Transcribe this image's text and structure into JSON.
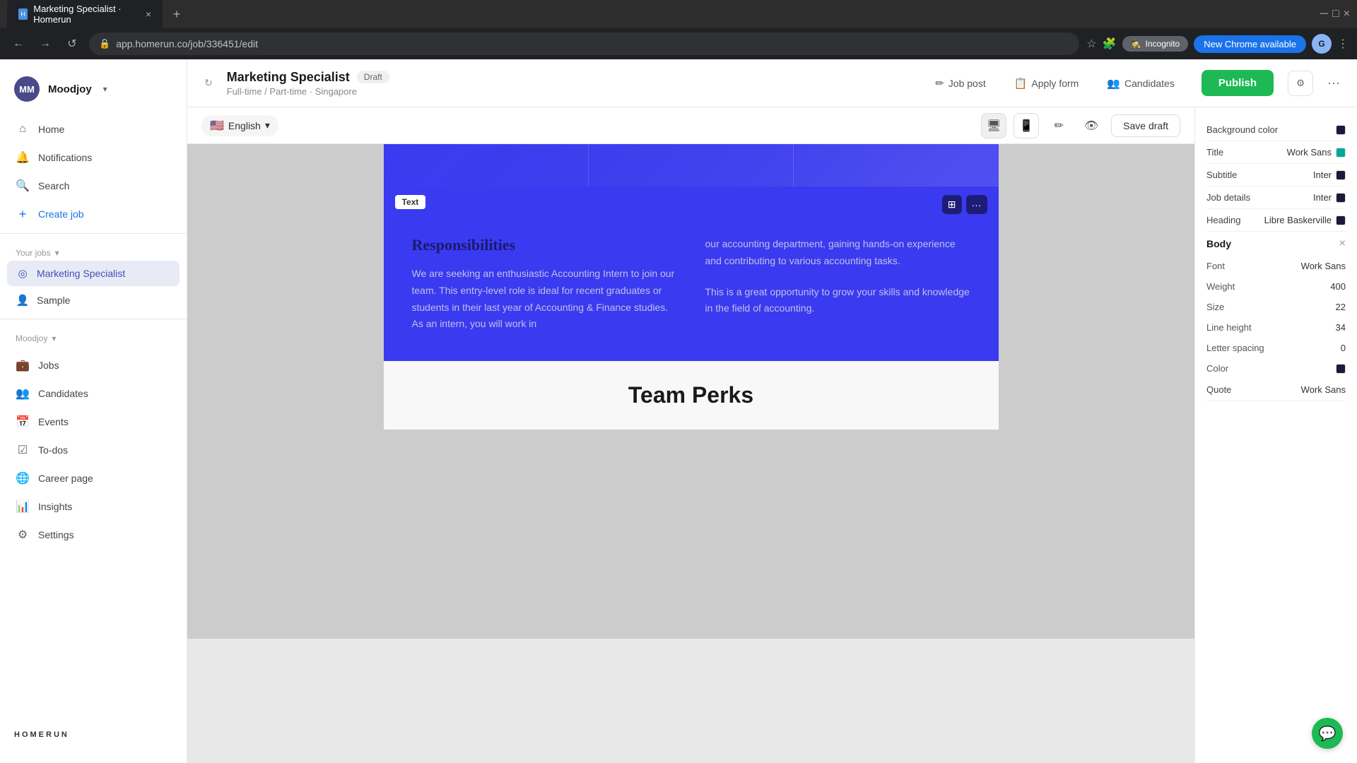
{
  "browser": {
    "tab_title": "Marketing Specialist · Homerun",
    "url": "app.homerun.co/job/336451/edit",
    "new_chrome_label": "New Chrome available",
    "incognito_label": "Incognito"
  },
  "sidebar": {
    "company": "Moodjoy",
    "avatar": "MM",
    "nav_items": [
      {
        "label": "Home",
        "icon": "⌂"
      },
      {
        "label": "Notifications",
        "icon": "🔔"
      },
      {
        "label": "Search",
        "icon": "🔍"
      },
      {
        "label": "Create job",
        "icon": "+"
      }
    ],
    "your_jobs_label": "Your jobs",
    "job_items": [
      {
        "label": "Marketing Specialist",
        "active": true
      },
      {
        "label": "Sample",
        "active": false
      }
    ],
    "moodjoy_label": "Moodjoy",
    "moodjoy_items": [
      {
        "label": "Jobs",
        "icon": "💼"
      },
      {
        "label": "Candidates",
        "icon": "👤"
      },
      {
        "label": "Events",
        "icon": "📅"
      },
      {
        "label": "To-dos",
        "icon": "☑"
      },
      {
        "label": "Career page",
        "icon": "🌐"
      },
      {
        "label": "Insights",
        "icon": "📊"
      },
      {
        "label": "Settings",
        "icon": "⚙"
      }
    ],
    "footer_logo": "HOMERUN"
  },
  "topbar": {
    "job_title": "Marketing Specialist",
    "badge": "Draft",
    "job_meta": "Full-time / Part-time · Singapore",
    "tabs": [
      {
        "label": "Job post",
        "icon": "✏",
        "active": false
      },
      {
        "label": "Apply form",
        "icon": "📋",
        "active": false
      },
      {
        "label": "Candidates",
        "icon": "👥",
        "active": false
      }
    ],
    "publish_label": "Publish",
    "settings_icon": "⚙",
    "more_icon": "···"
  },
  "editor_toolbar": {
    "language": "English",
    "flag": "🇺🇸",
    "device_desktop": "🖥",
    "device_mobile": "📱",
    "edit_icon": "✏",
    "preview_icon": "👁",
    "save_draft": "Save draft"
  },
  "canvas": {
    "text_block_label": "Text",
    "section_title": "Responsibilities",
    "col1_text": "We are seeking an enthusiastic Accounting Intern to join our team. This entry-level role is ideal for recent graduates or students in their last year of Accounting & Finance studies. As an intern, you will work in",
    "col2_text1": "our accounting department, gaining hands-on experience and contributing to various accounting tasks.",
    "col2_text2": "This is a great opportunity to grow your skills and knowledge in the field of accounting.",
    "team_perks": "Team Perks"
  },
  "right_panel": {
    "background_color_label": "Background color",
    "typography_items": [
      {
        "label": "Title",
        "font": "Work Sans",
        "has_color": true,
        "color_class": "color-teal"
      },
      {
        "label": "Subtitle",
        "font": "Inter",
        "has_color": true,
        "color_class": "color-dark"
      },
      {
        "label": "Job details",
        "font": "Inter",
        "has_color": true,
        "color_class": "color-dark"
      },
      {
        "label": "Heading",
        "font": "Libre Baskerville",
        "has_color": true,
        "color_class": "color-dark"
      }
    ],
    "body_section": {
      "title": "Body",
      "font_label": "Font",
      "font_value": "Work Sans",
      "weight_label": "Weight",
      "weight_value": "400",
      "size_label": "Size",
      "size_value": "22",
      "line_height_label": "Line height",
      "line_height_value": "34",
      "letter_spacing_label": "Letter spacing",
      "letter_spacing_value": "0",
      "color_label": "Color",
      "color_class": "color-dark"
    },
    "quote_label": "Quote",
    "quote_font": "Work Sans"
  }
}
